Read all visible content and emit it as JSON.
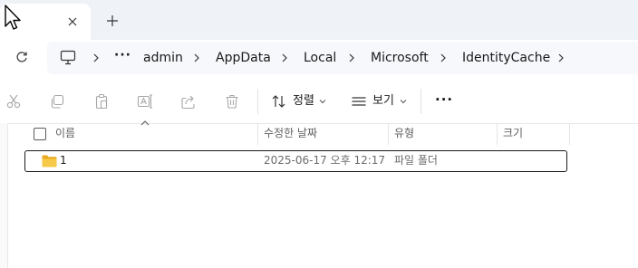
{
  "window": {
    "active_tab": {
      "title": "",
      "close_icon": "close-icon"
    },
    "new_tab_icon": "plus-icon"
  },
  "address_bar": {
    "refresh_icon": "refresh-icon",
    "breadcrumb": [
      {
        "label": "admin"
      },
      {
        "label": "AppData"
      },
      {
        "label": "Local"
      },
      {
        "label": "Microsoft"
      },
      {
        "label": "IdentityCache"
      }
    ],
    "overflow_label": "···"
  },
  "toolbar": {
    "sort_label": "정렬",
    "view_label": "보기",
    "more_label": "···"
  },
  "columns": {
    "name": "이름",
    "date_modified": "수정한 날짜",
    "type": "유형",
    "size": "크기"
  },
  "files": [
    {
      "name": "1",
      "date_modified": "2025-06-17 오후 12:17",
      "type": "파일 폴더",
      "size": ""
    }
  ],
  "colors": {
    "folder": "#f5c242",
    "accent": "#0067c0"
  }
}
